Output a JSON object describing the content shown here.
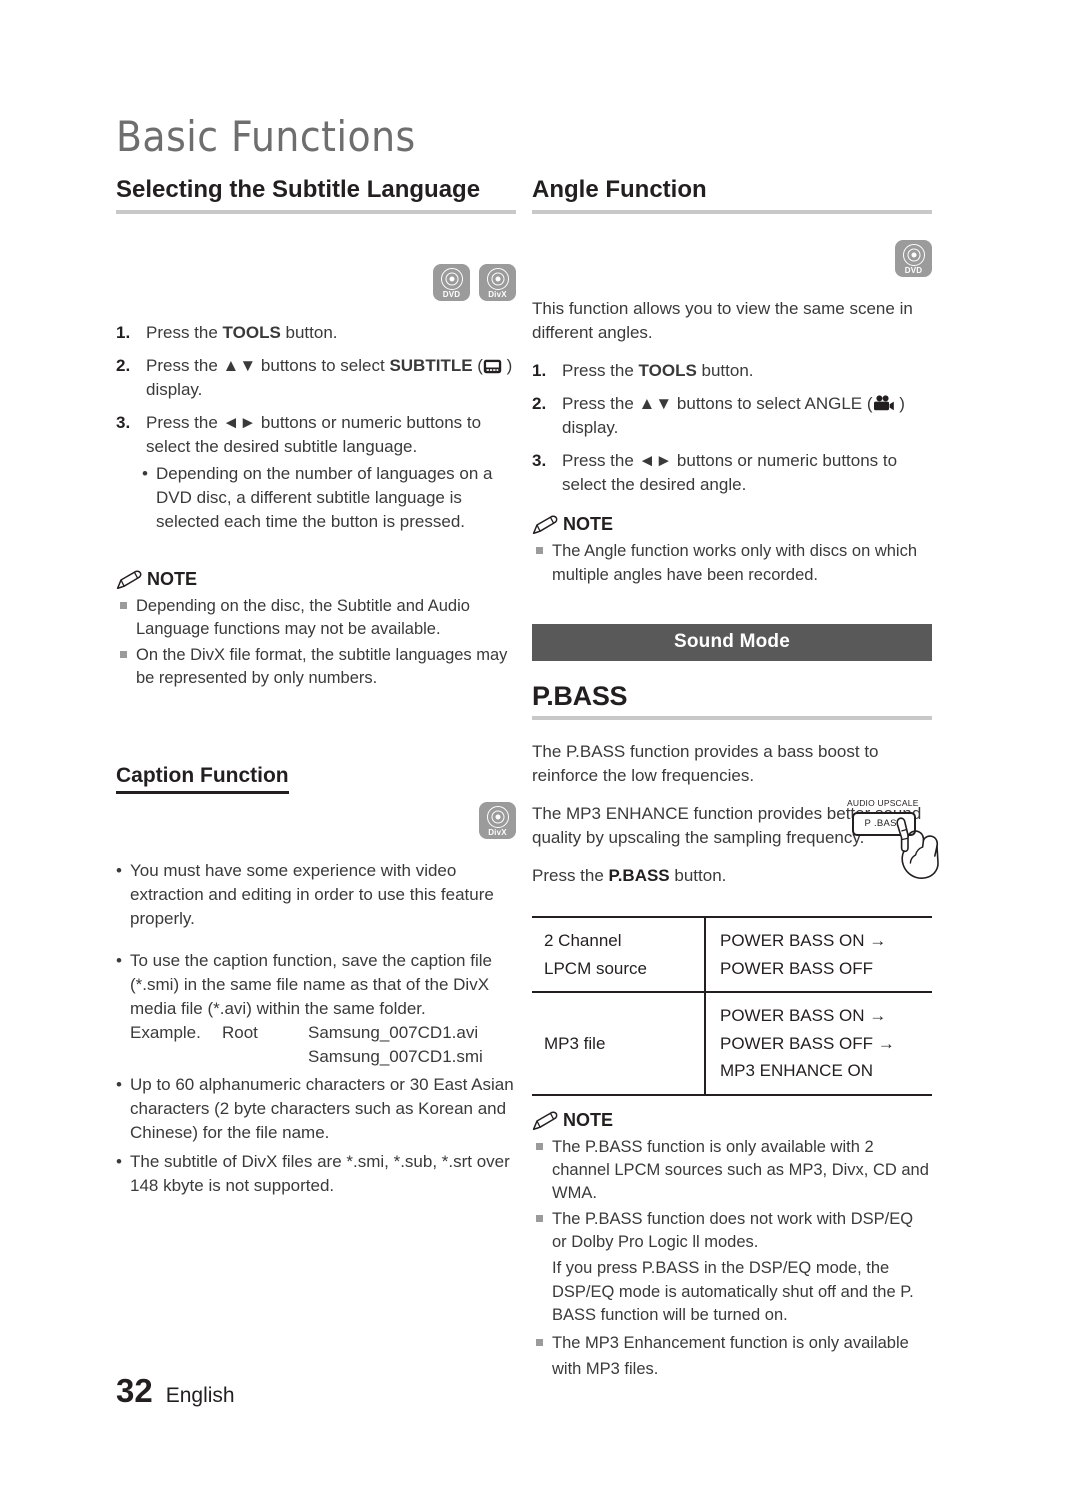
{
  "chapter": {
    "title": "Basic Functions"
  },
  "footer": {
    "page_number": "32",
    "language": "English"
  },
  "left_column": {
    "section_title": "Selecting the Subtitle Language",
    "media_icons": [
      {
        "name": "dvd-media-icon",
        "label": "DVD"
      },
      {
        "name": "divx-media-icon",
        "label": "DivX"
      }
    ],
    "steps": [
      {
        "num": "1.",
        "pre": "Press the ",
        "bold": "TOOLS",
        "post": " button."
      },
      {
        "num": "2.",
        "pre": "Press the ▲▼ buttons to select ",
        "bold": "SUBTITLE",
        "icon": "subtitle-icon",
        "post": " display."
      },
      {
        "num": "3.",
        "pre": "Press the ◄► buttons or numeric buttons to select the desired subtitle language.",
        "bold": "",
        "post": ""
      }
    ],
    "step3_subbullet": "Depending on the number of languages on a DVD disc, a different subtitle language is selected each time the button is pressed.",
    "note": {
      "heading": "NOTE",
      "items": [
        "Depending on the disc, the Subtitle and Audio Language functions may not be available.",
        "On the DivX file format, the subtitle languages may be represented by only numbers."
      ]
    },
    "caption_section": {
      "title": "Caption Function",
      "media_icon": {
        "name": "divx-media-icon",
        "label": "DivX"
      },
      "bullets": [
        "You must have some experience with video extraction and editing in order to use this feature properly.",
        "To use the caption function, save the caption file (*.smi) in the same file name as that of the DivX media file (*.avi) within the same folder.",
        "Up to 60 alphanumeric characters or 30 East Asian characters (2 byte characters such as Korean and Chinese) for the file name.",
        "The subtitle of DivX files are *.smi, *.sub, *.srt over 148 kbyte is not supported."
      ],
      "example": {
        "label": "Example.",
        "root": "Root",
        "file_avi": "Samsung_007CD1.avi",
        "file_smi": "Samsung_007CD1.smi"
      }
    }
  },
  "right_column": {
    "angle_section": {
      "title": "Angle Function",
      "media_icon": {
        "name": "dvd-media-icon",
        "label": "DVD"
      },
      "intro": "This function allows you to view the same scene in different angles.",
      "steps": [
        {
          "num": "1.",
          "pre": "Press the ",
          "bold": "TOOLS",
          "post": " button."
        },
        {
          "num": "2.",
          "pre": "Press the ▲▼ buttons to select ANGLE",
          "icon": "movie-camera-icon",
          "post": " display.",
          "bold": ""
        },
        {
          "num": "3.",
          "pre": "Press the ◄► buttons or numeric buttons to select the desired angle.",
          "bold": "",
          "post": ""
        }
      ],
      "note": {
        "heading": "NOTE",
        "items": [
          "The Angle function works only with discs on which multiple angles have been recorded."
        ]
      }
    },
    "sound_mode": {
      "banner": "Sound Mode",
      "title": "P.BASS",
      "paragraph_1": "The P.BASS function provides a bass boost to reinforce the low frequencies.",
      "paragraph_2": "The MP3 ENHANCE function provides better sound quality by upscaling the sampling frequency.",
      "press_pre": "Press the ",
      "press_bold": "P.BASS",
      "press_post": " button.",
      "button_art": {
        "upscale_label": "AUDIO UPSCALE",
        "button_label": "P .BASS"
      },
      "table": {
        "rows": [
          {
            "source_lines": [
              "2 Channel",
              "LPCM source"
            ],
            "modes": [
              "POWER BASS ON →",
              "POWER BASS OFF"
            ]
          },
          {
            "source_lines": [
              "MP3 file"
            ],
            "modes": [
              "POWER BASS ON →",
              "POWER BASS OFF →",
              "MP3 ENHANCE ON"
            ]
          }
        ]
      },
      "note": {
        "heading": "NOTE",
        "items": [
          "The P.BASS function is only available with 2 channel LPCM sources such as MP3, Divx, CD and WMA.",
          "The P.BASS function does not work with DSP/EQ or Dolby Pro Logic ll modes.",
          "If you press P.BASS in the DSP/EQ mode, the DSP/EQ mode is automatically shut off and the P. BASS function will be turned on.",
          "The MP3 Enhancement function is only available with MP3 files."
        ]
      }
    }
  },
  "colors": {
    "banner_bg": "#595959",
    "rule_gray": "#c8c8c8",
    "icon_gray": "#9b9b9b",
    "text": "#231f20"
  }
}
